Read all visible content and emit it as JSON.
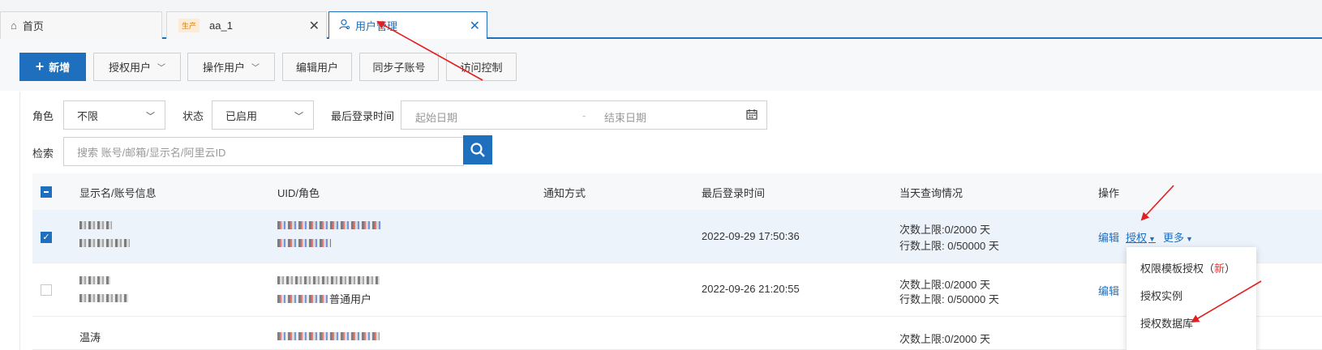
{
  "tabs": [
    {
      "label": "首页",
      "icon": "home-icon"
    },
    {
      "label": "aa_1",
      "badge": "生产",
      "icon": "close-icon"
    },
    {
      "label": "用户管理",
      "icon": "user-icon",
      "active": true
    }
  ],
  "toolbar": {
    "new_label": "新增",
    "grant_users_label": "授权用户",
    "operate_users_label": "操作用户",
    "edit_user_label": "编辑用户",
    "sync_sub_label": "同步子账号",
    "access_control_label": "访问控制"
  },
  "filters": {
    "role_label": "角色",
    "role_value": "不限",
    "status_label": "状态",
    "status_value": "已启用",
    "last_login_label": "最后登录时间",
    "start_placeholder": "起始日期",
    "range_sep": "-",
    "end_placeholder": "结束日期",
    "search_label": "检索",
    "search_placeholder": "搜索 账号/邮箱/显示名/阿里云ID"
  },
  "table": {
    "headers": [
      "显示名/账号信息",
      "UID/角色",
      "通知方式",
      "最后登录时间",
      "当天查询情况",
      "操作"
    ],
    "rows": [
      {
        "checked": true,
        "role_suffix": "",
        "last_login": "2022-09-29 17:50:36",
        "query_line1": "次数上限:0/2000 天",
        "query_line2": "行数上限: 0/50000 天"
      },
      {
        "checked": false,
        "role_suffix": "普通用户",
        "last_login": "2022-09-26 21:20:55",
        "query_line1": "次数上限:0/2000 天",
        "query_line2": "行数上限: 0/50000 天"
      },
      {
        "checked": false,
        "name_partial": "温涛",
        "query_line1": "次数上限:0/2000 天"
      }
    ],
    "actions": {
      "edit": "编辑",
      "grant": "授权",
      "more": "更多"
    }
  },
  "dropdown": {
    "item1": "权限模板授权（",
    "item1_new": "新",
    "item1_close": "）",
    "item2": "授权实例",
    "item3": "授权数据库"
  },
  "colors": {
    "accent": "#1f6fbf",
    "arrow": "#e02020",
    "new_badge": "#e0413c"
  }
}
